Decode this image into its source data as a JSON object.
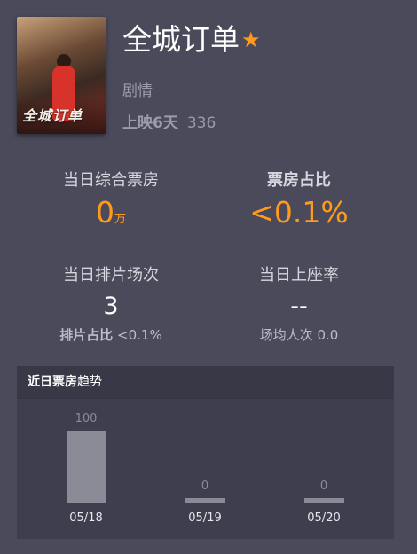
{
  "movie": {
    "title": "全城订单",
    "poster_text": "全城订单",
    "genre": "剧情",
    "release_days": "上映6天",
    "release_num": "336"
  },
  "stats": {
    "box_office_label": "当日综合票房",
    "box_office_value": "0",
    "box_office_unit": "万",
    "share_label": "票房占比",
    "share_value": "<0.1%",
    "shows_label": "当日排片场次",
    "shows_value": "3",
    "shows_share_label": "排片占比",
    "shows_share_value": "<0.1%",
    "occupancy_label": "当日上座率",
    "occupancy_value": "--",
    "avg_audience_label": "场均人次",
    "avg_audience_value": "0.0"
  },
  "trend": {
    "title_bold": "近日票房",
    "title_rest": "趋势"
  },
  "chart_data": {
    "type": "bar",
    "categories": [
      "05/18",
      "05/19",
      "05/20"
    ],
    "values": [
      100,
      0,
      0
    ],
    "title": "近日票房趋势",
    "ylim": [
      0,
      100
    ]
  },
  "colors": {
    "accent": "#ff9a1c",
    "background": "#4a4a5a",
    "bar": "#8b8b97"
  }
}
